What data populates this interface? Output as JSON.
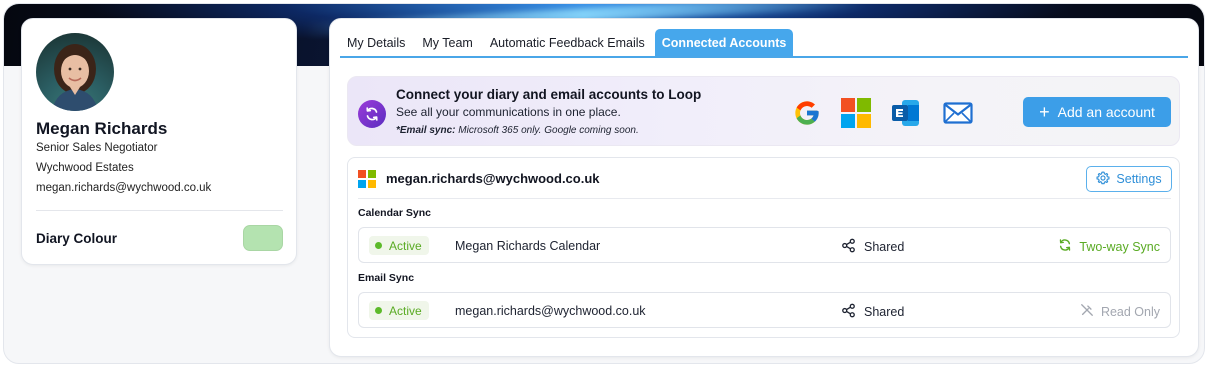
{
  "profile": {
    "name": "Megan Richards",
    "role": "Senior Sales Negotiator",
    "company": "Wychwood Estates",
    "email": "megan.richards@wychwood.co.uk",
    "diary_colour_label": "Diary Colour",
    "diary_colour": "#b4e3b0"
  },
  "tabs": [
    {
      "label": "My Details",
      "active": false
    },
    {
      "label": "My Team",
      "active": false
    },
    {
      "label": "Automatic Feedback Emails",
      "active": false
    },
    {
      "label": "Connected Accounts",
      "active": true
    }
  ],
  "banner": {
    "title": "Connect your diary and email accounts to Loop",
    "subtitle": "See all your communications in one place.",
    "note_label": "*Email sync:",
    "note_text": " Microsoft 365 only. Google coming soon.",
    "providers": [
      "google-icon",
      "microsoft-icon",
      "exchange-icon",
      "mail-icon"
    ],
    "add_button_label": "Add an account"
  },
  "account": {
    "email": "megan.richards@wychwood.co.uk",
    "settings_label": "Settings",
    "calendar_section_label": "Calendar Sync",
    "email_section_label": "Email Sync",
    "calendar_row": {
      "status": "Active",
      "name": "Megan Richards Calendar",
      "shared": "Shared",
      "mode": "Two-way Sync"
    },
    "email_row": {
      "status": "Active",
      "name": "megan.richards@wychwood.co.uk",
      "shared": "Shared",
      "mode": "Read Only"
    }
  },
  "colors": {
    "accent": "#3c9ee8",
    "active_green": "#5aab24",
    "muted": "#a3a7b0",
    "purple": "#7a35cf"
  }
}
